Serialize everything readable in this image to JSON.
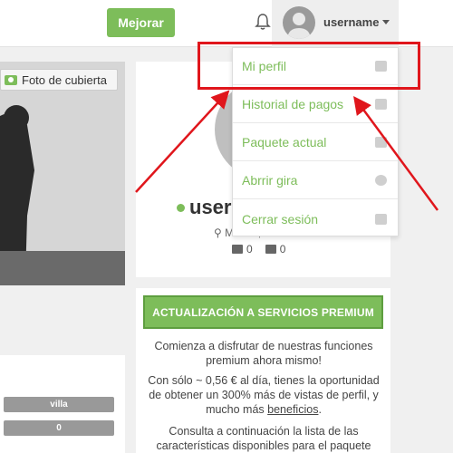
{
  "header": {
    "upgrade_label": "Mejorar",
    "username": "username"
  },
  "cover": {
    "button_label": "Foto de cubierta"
  },
  "dropdown": {
    "items": [
      {
        "label": "Mi perfil",
        "icon": "user-icon"
      },
      {
        "label": "Historial de pagos",
        "icon": "credit-card-icon"
      },
      {
        "label": "Paquete actual",
        "icon": "package-icon"
      },
      {
        "label": "Abrrir gira",
        "icon": "globe-icon"
      },
      {
        "label": "Cerrar sesión",
        "icon": "sign-out-icon"
      }
    ]
  },
  "profile": {
    "name": "userr",
    "location": "Madrid, Madrid",
    "friends_count": "0",
    "photos_count": "0"
  },
  "left_panel": {
    "pill1": "villa",
    "pill2": "0"
  },
  "premium": {
    "button_label": "ACTUALIZACIÓN A SERVICIOS PREMIUM",
    "text1": "Comienza a disfrutar de nuestras funciones premium ahora mismo!",
    "text2_pre": "Con sólo ~ 0,56 € al día, tienes la oportunidad de obtener un 300% más de vistas de perfil, y mucho más ",
    "text2_link": "beneficios",
    "text2_post": ".",
    "text3": "Consulta a continuación la lista de las características disponibles para el paquete"
  },
  "colors": {
    "accent": "#7dbd5a",
    "highlight": "#e0161c"
  }
}
